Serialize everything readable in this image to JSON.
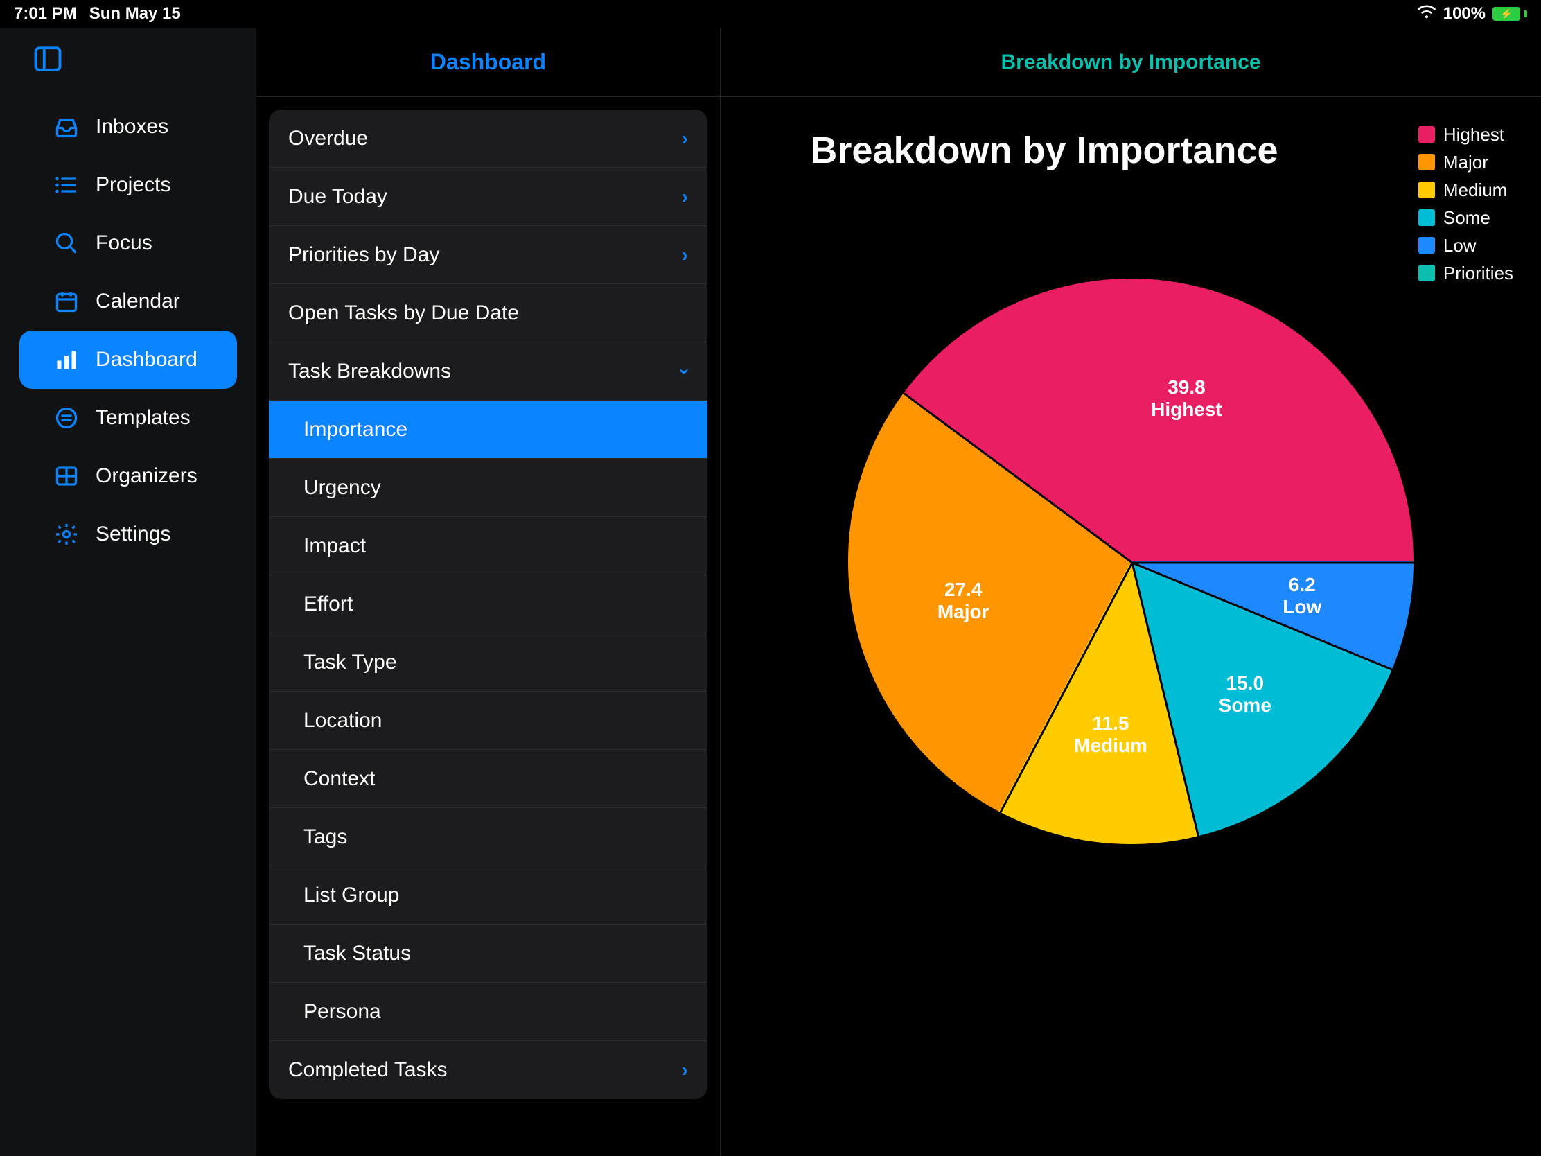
{
  "status": {
    "time": "7:01 PM",
    "date": "Sun May 15",
    "battery_pct": "100%"
  },
  "sidebar": {
    "items": [
      {
        "label": "Inboxes"
      },
      {
        "label": "Projects"
      },
      {
        "label": "Focus"
      },
      {
        "label": "Calendar"
      },
      {
        "label": "Dashboard"
      },
      {
        "label": "Templates"
      },
      {
        "label": "Organizers"
      },
      {
        "label": "Settings"
      }
    ],
    "active_index": 4
  },
  "panel": {
    "title": "Dashboard",
    "sections": [
      {
        "label": "Overdue",
        "chevron": "right"
      },
      {
        "label": "Due Today",
        "chevron": "right"
      },
      {
        "label": "Priorities by Day",
        "chevron": "right"
      },
      {
        "label": "Open Tasks by Due Date",
        "chevron": null
      },
      {
        "label": "Task Breakdowns",
        "chevron": "down"
      }
    ],
    "sub_items": [
      {
        "label": "Importance",
        "selected": true
      },
      {
        "label": "Urgency"
      },
      {
        "label": "Impact"
      },
      {
        "label": "Effort"
      },
      {
        "label": "Task Type"
      },
      {
        "label": "Location"
      },
      {
        "label": "Context"
      },
      {
        "label": "Tags"
      },
      {
        "label": "List Group"
      },
      {
        "label": "Task Status"
      },
      {
        "label": "Persona"
      }
    ],
    "tail_section": {
      "label": "Completed Tasks",
      "chevron": "right"
    }
  },
  "detail": {
    "header": "Breakdown by Importance",
    "chart_title": "Breakdown by Importance"
  },
  "colors": {
    "Highest": "#e91e63",
    "Major": "#ff9500",
    "Medium": "#ffcc00",
    "Some": "#00bcd4",
    "Low": "#1e88ff",
    "Priorities": "#0bbfaf"
  },
  "legend": [
    "Highest",
    "Major",
    "Medium",
    "Some",
    "Low",
    "Priorities"
  ],
  "chart_data": {
    "type": "pie",
    "title": "Breakdown by Importance",
    "series": [
      {
        "name": "Highest",
        "value": 39.8,
        "color": "#e91e63"
      },
      {
        "name": "Major",
        "value": 27.4,
        "color": "#ff9500"
      },
      {
        "name": "Medium",
        "value": 11.5,
        "color": "#ffcc00"
      },
      {
        "name": "Some",
        "value": 15.0,
        "color": "#00bcd4"
      },
      {
        "name": "Low",
        "value": 6.2,
        "color": "#1e88ff"
      }
    ],
    "start_angle_deg": 90,
    "direction": "counterclockwise"
  }
}
